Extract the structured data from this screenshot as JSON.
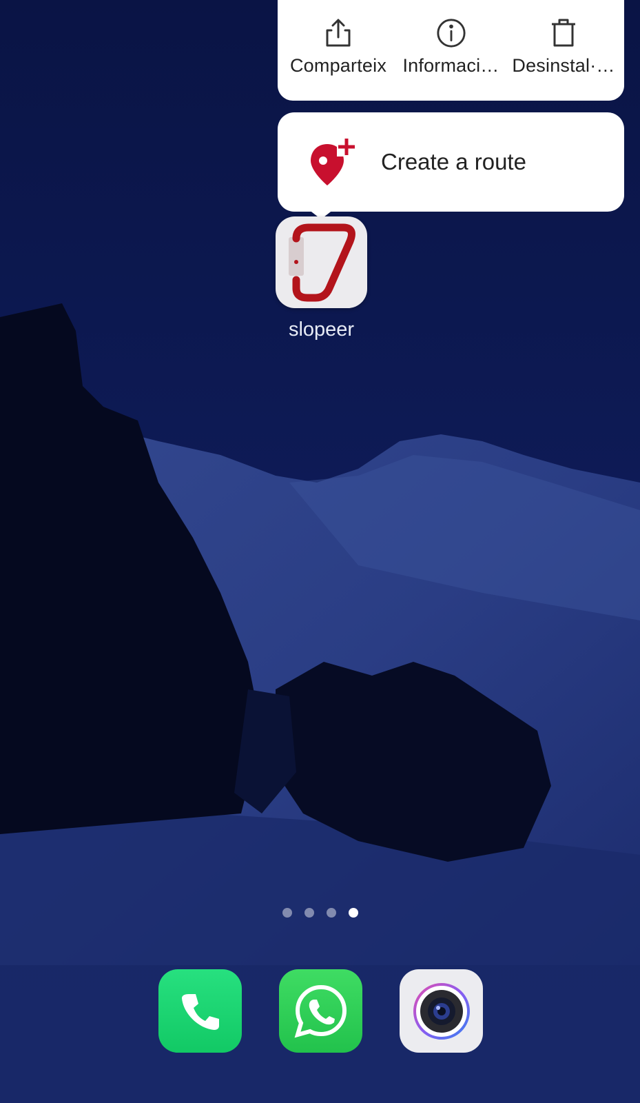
{
  "quick_actions": [
    {
      "label": "Comparteix",
      "icon": "share-icon"
    },
    {
      "label": "Informaci…",
      "icon": "info-icon"
    },
    {
      "label": "Desinstal·…",
      "icon": "trash-icon"
    }
  ],
  "shortcut": {
    "label": "Create a route",
    "icon": "add-location-pin-icon",
    "color": "#c8102e"
  },
  "app": {
    "name": "slopeer",
    "icon": "carabiner-icon",
    "color": "#b3141b"
  },
  "page_indicator": {
    "total": 4,
    "active_index": 3
  },
  "dock": [
    {
      "name": "phone",
      "icon": "phone-icon",
      "color": "#1fd971"
    },
    {
      "name": "whatsapp",
      "icon": "whatsapp-icon",
      "color": "#2ecc58"
    },
    {
      "name": "camera",
      "icon": "camera-icon",
      "color": "#ececf0"
    }
  ],
  "colors": {
    "wallpaper_sky": "#0b1648",
    "card_background": "#ffffff"
  }
}
